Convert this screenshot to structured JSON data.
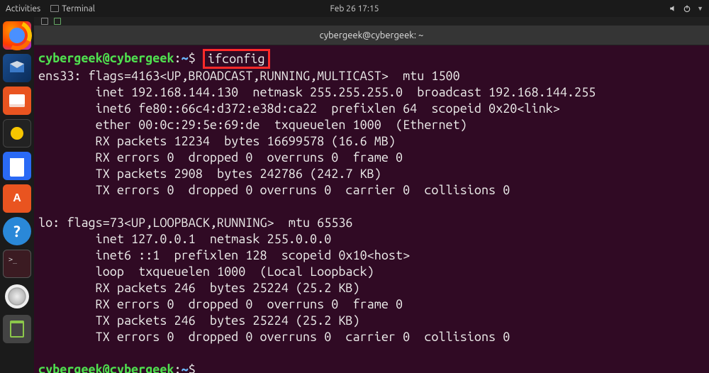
{
  "topbar": {
    "activities": "Activities",
    "app_label": "Terminal",
    "datetime": "Feb 26  17:15"
  },
  "dock": [
    {
      "name": "firefox-launcher"
    },
    {
      "name": "thunderbird-launcher"
    },
    {
      "name": "files-launcher"
    },
    {
      "name": "rhythmbox-launcher"
    },
    {
      "name": "libreoffice-writer-launcher"
    },
    {
      "name": "software-center-launcher"
    },
    {
      "name": "help-launcher"
    },
    {
      "name": "terminal-launcher"
    },
    {
      "name": "disk-launcher"
    },
    {
      "name": "trash-launcher"
    }
  ],
  "window": {
    "title": "cybergeek@cybergeek: ~"
  },
  "terminal": {
    "prompt_user": "cybergeek@cybergeek",
    "prompt_sep": ":",
    "prompt_path": "~",
    "prompt_dollar": "$",
    "command": "ifconfig",
    "output": "ens33: flags=4163<UP,BROADCAST,RUNNING,MULTICAST>  mtu 1500\n        inet 192.168.144.130  netmask 255.255.255.0  broadcast 192.168.144.255\n        inet6 fe80::66c4:d372:e38d:ca22  prefixlen 64  scopeid 0x20<link>\n        ether 00:0c:29:5e:69:de  txqueuelen 1000  (Ethernet)\n        RX packets 12234  bytes 16699578 (16.6 MB)\n        RX errors 0  dropped 0  overruns 0  frame 0\n        TX packets 2908  bytes 242786 (242.7 KB)\n        TX errors 0  dropped 0 overruns 0  carrier 0  collisions 0\n\nlo: flags=73<UP,LOOPBACK,RUNNING>  mtu 65536\n        inet 127.0.0.1  netmask 255.0.0.0\n        inet6 ::1  prefixlen 128  scopeid 0x10<host>\n        loop  txqueuelen 1000  (Local Loopback)\n        RX packets 246  bytes 25224 (25.2 KB)\n        RX errors 0  dropped 0  overruns 0  frame 0\n        TX packets 246  bytes 25224 (25.2 KB)\n        TX errors 0  dropped 0 overruns 0  carrier 0  collisions 0\n"
  }
}
